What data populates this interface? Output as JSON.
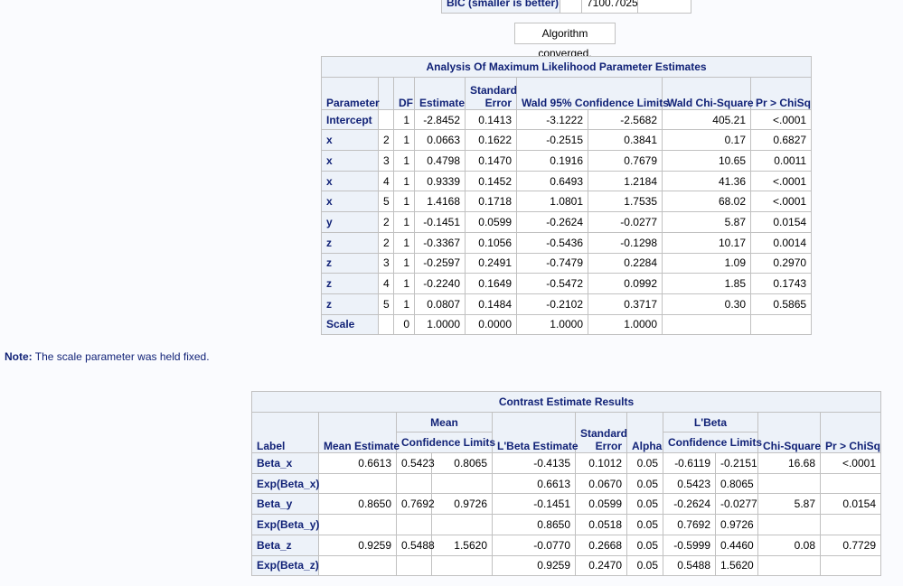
{
  "fit_table": {
    "label": "BIC (smaller is better)",
    "value": "7100.7025"
  },
  "converged": "Algorithm converged.",
  "mle": {
    "title": "Analysis Of Maximum Likelihood Parameter Estimates",
    "headers": {
      "parameter": "Parameter",
      "df": "DF",
      "estimate": "Estimate",
      "se_top": "Standard",
      "se_bottom": "Error",
      "wald": "Wald 95% Confidence Limits",
      "chisq": "Wald Chi-Square",
      "p": "Pr > ChiSq"
    },
    "rows": [
      [
        "Intercept",
        "",
        "1",
        "-2.8452",
        "0.1413",
        "-3.1222",
        "-2.5682",
        "405.21",
        "<.0001"
      ],
      [
        "x",
        "2",
        "1",
        "0.0663",
        "0.1622",
        "-0.2515",
        "0.3841",
        "0.17",
        "0.6827"
      ],
      [
        "x",
        "3",
        "1",
        "0.4798",
        "0.1470",
        "0.1916",
        "0.7679",
        "10.65",
        "0.0011"
      ],
      [
        "x",
        "4",
        "1",
        "0.9339",
        "0.1452",
        "0.6493",
        "1.2184",
        "41.36",
        "<.0001"
      ],
      [
        "x",
        "5",
        "1",
        "1.4168",
        "0.1718",
        "1.0801",
        "1.7535",
        "68.02",
        "<.0001"
      ],
      [
        "y",
        "2",
        "1",
        "-0.1451",
        "0.0599",
        "-0.2624",
        "-0.0277",
        "5.87",
        "0.0154"
      ],
      [
        "z",
        "2",
        "1",
        "-0.3367",
        "0.1056",
        "-0.5436",
        "-0.1298",
        "10.17",
        "0.0014"
      ],
      [
        "z",
        "3",
        "1",
        "-0.2597",
        "0.2491",
        "-0.7479",
        "0.2284",
        "1.09",
        "0.2970"
      ],
      [
        "z",
        "4",
        "1",
        "-0.2240",
        "0.1649",
        "-0.5472",
        "0.0992",
        "1.85",
        "0.1743"
      ],
      [
        "z",
        "5",
        "1",
        "0.0807",
        "0.1484",
        "-0.2102",
        "0.3717",
        "0.30",
        "0.5865"
      ],
      [
        "Scale",
        "",
        "0",
        "1.0000",
        "0.0000",
        "1.0000",
        "1.0000",
        "",
        ""
      ]
    ]
  },
  "note": {
    "label": "Note:",
    "text": " The scale parameter was held fixed."
  },
  "contrast": {
    "title": "Contrast Estimate Results",
    "headers": {
      "label": "Label",
      "mean_est": "Mean Estimate",
      "mean": "Mean",
      "mean_cl": "Confidence Limits",
      "lbeta_est": "L'Beta Estimate",
      "se_top": "Standard",
      "se_bottom": "Error",
      "alpha": "Alpha",
      "lbeta": "L'Beta",
      "lbeta_cl": "Confidence Limits",
      "chisq": "Chi-Square",
      "p": "Pr > ChiSq"
    },
    "rows": [
      [
        "Beta_x",
        "0.6613",
        "0.5423",
        "0.8065",
        "-0.4135",
        "0.1012",
        "0.05",
        "-0.6119",
        "-0.2151",
        "16.68",
        "<.0001"
      ],
      [
        "Exp(Beta_x)",
        "",
        "",
        "",
        "0.6613",
        "0.0670",
        "0.05",
        "0.5423",
        "0.8065",
        "",
        ""
      ],
      [
        "Beta_y",
        "0.8650",
        "0.7692",
        "0.9726",
        "-0.1451",
        "0.0599",
        "0.05",
        "-0.2624",
        "-0.0277",
        "5.87",
        "0.0154"
      ],
      [
        "Exp(Beta_y)",
        "",
        "",
        "",
        "0.8650",
        "0.0518",
        "0.05",
        "0.7692",
        "0.9726",
        "",
        ""
      ],
      [
        "Beta_z",
        "0.9259",
        "0.5488",
        "1.5620",
        "-0.0770",
        "0.2668",
        "0.05",
        "-0.5999",
        "0.4460",
        "0.08",
        "0.7729"
      ],
      [
        "Exp(Beta_z)",
        "",
        "",
        "",
        "0.9259",
        "0.2470",
        "0.05",
        "0.5488",
        "1.5620",
        "",
        ""
      ]
    ]
  }
}
